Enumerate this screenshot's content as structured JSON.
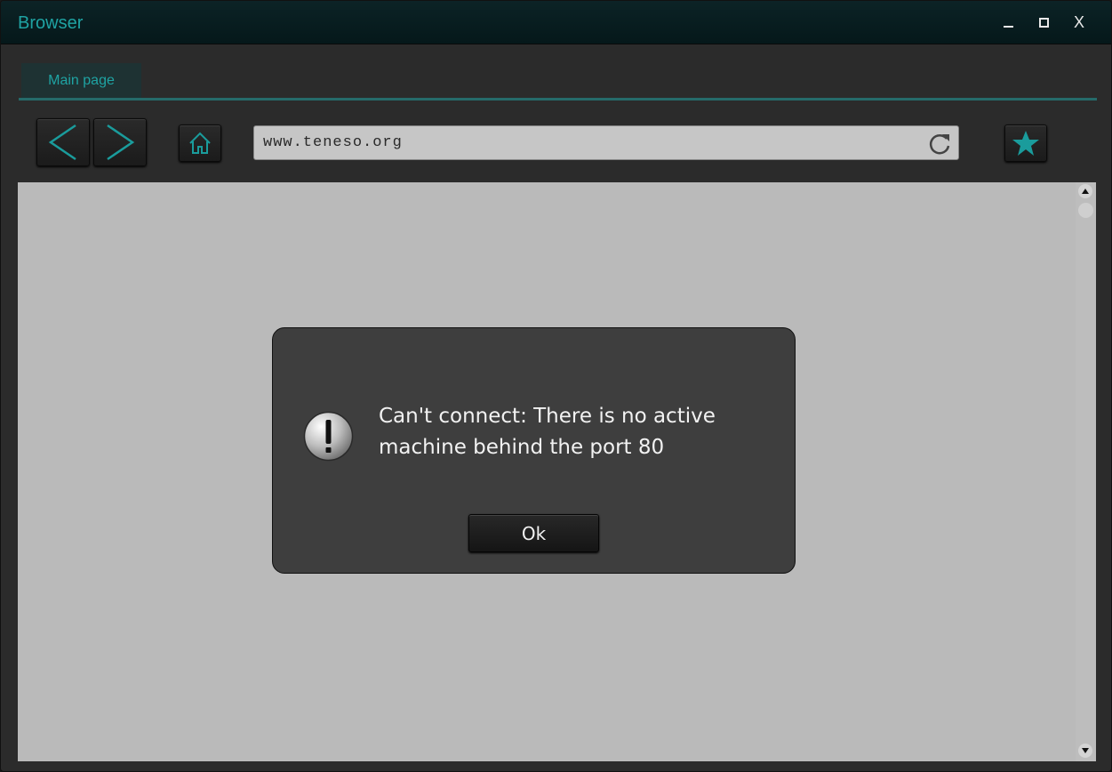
{
  "window": {
    "title": "Browser",
    "minimize_icon": "minimize-icon",
    "maximize_icon": "maximize-icon",
    "close_label": "X"
  },
  "tabs": [
    {
      "label": "Main page",
      "active": true
    }
  ],
  "toolbar": {
    "back_icon": "chevron-left-icon",
    "forward_icon": "chevron-right-icon",
    "home_icon": "home-icon",
    "url": "www.teneso.org",
    "reload_icon": "reload-icon",
    "bookmark_icon": "star-icon"
  },
  "dialog": {
    "icon": "warning-icon",
    "message": "Can't connect: There is no active machine behind the port 80",
    "ok_label": "Ok"
  },
  "colors": {
    "accent": "#1fa3a3",
    "titlebar": "#05181a",
    "page_background": "#bababa",
    "dialog_background": "#3e3e3e"
  }
}
